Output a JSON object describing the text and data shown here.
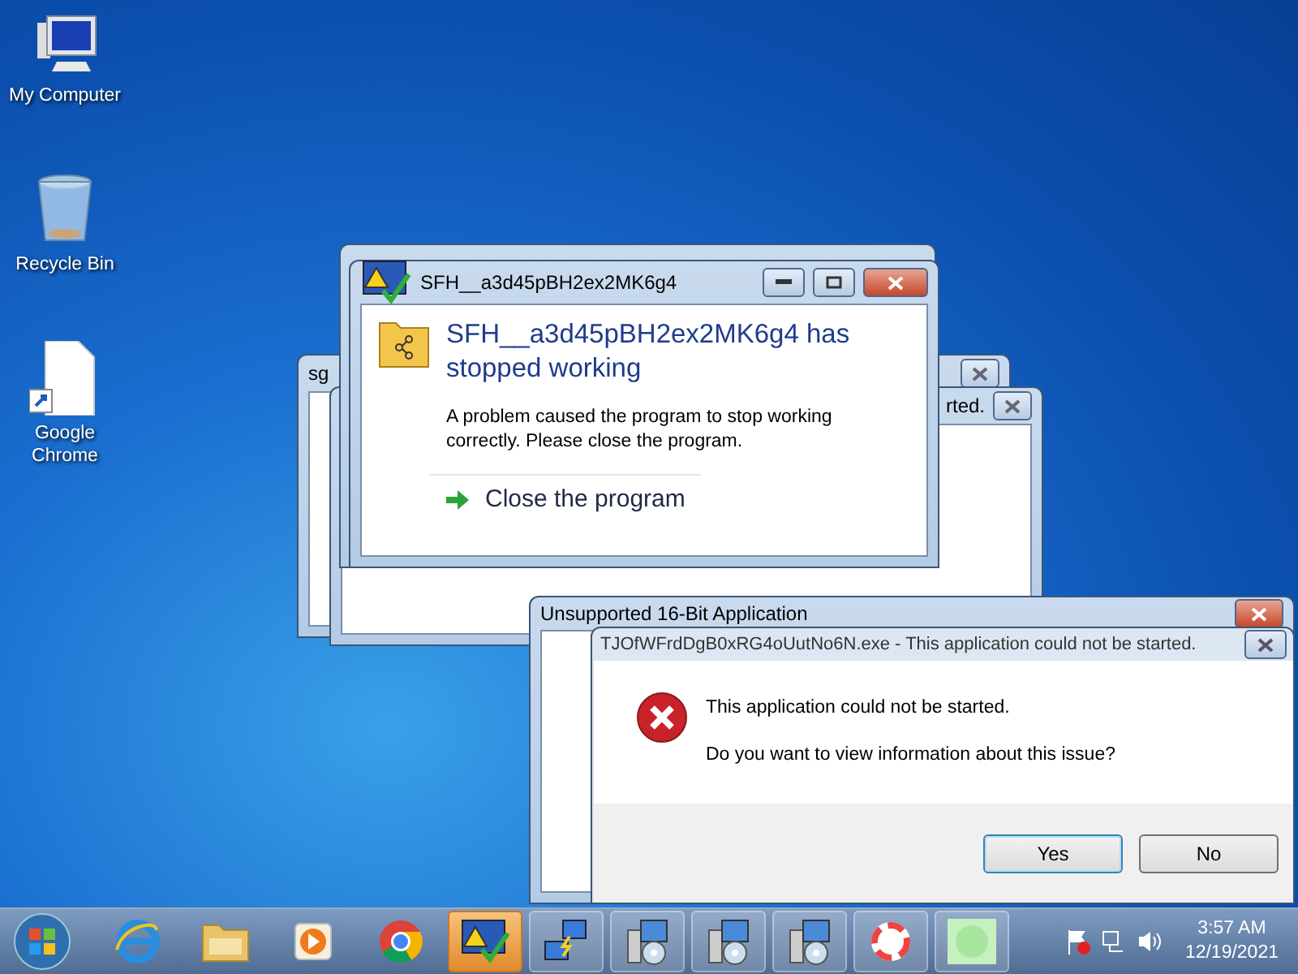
{
  "desktop_icons": [
    {
      "kind": "computer",
      "label": "My Computer"
    },
    {
      "kind": "bin",
      "label": "Recycle Bin"
    },
    {
      "kind": "shortcut",
      "label": "Google Chrome"
    }
  ],
  "background_windows": [
    {
      "title": "sg"
    },
    {
      "title": "rted."
    }
  ],
  "crash_dialog": {
    "title": "SFH__a3d45pBH2ex2MK6g4",
    "heading": "SFH__a3d45pBH2ex2MK6g4 has stopped working",
    "message": "A problem caused the program to stop working correctly. Please close the program.",
    "action": "Close the program"
  },
  "unsupported_window": {
    "title": "Unsupported 16-Bit Application"
  },
  "error_dialog": {
    "title": "TJOfWFrdDgB0xRG4oUutNo6N.exe - This application could not be started.",
    "message": "This application could not be started.",
    "question": "Do you want to view information about this issue?",
    "buttons": [
      {
        "label": "Yes",
        "selected": true
      },
      {
        "label": "No",
        "selected": false
      }
    ]
  },
  "taskbar": {
    "items": [
      {
        "kind": "ie",
        "selected": false
      },
      {
        "kind": "folder",
        "selected": false
      },
      {
        "kind": "media",
        "selected": false
      },
      {
        "kind": "chrome",
        "selected": false
      },
      {
        "kind": "warning",
        "selected": true
      },
      {
        "kind": "network",
        "selected": false
      },
      {
        "kind": "installer",
        "selected": false
      },
      {
        "kind": "installer",
        "selected": false
      },
      {
        "kind": "installer",
        "selected": false
      },
      {
        "kind": "picasa",
        "selected": false
      },
      {
        "kind": "blank",
        "selected": false
      }
    ],
    "clock": {
      "time": "3:57 AM",
      "date": "12/19/2021"
    }
  }
}
